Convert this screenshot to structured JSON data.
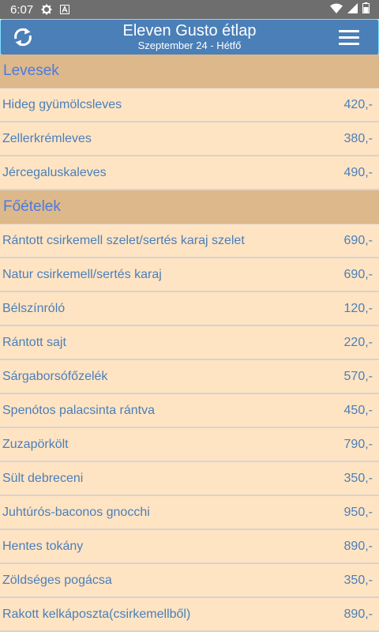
{
  "status_bar": {
    "time": "6:07",
    "icons": [
      "settings-gear-icon",
      "a-notification-icon",
      "wifi-icon",
      "signal-icon",
      "battery-icon"
    ]
  },
  "app_bar": {
    "title": "Eleven Gusto étlap",
    "subtitle": "Szeptember 24 - Hétfő",
    "left_icon": "refresh-icon",
    "right_icon": "hamburger-menu-icon"
  },
  "colors": {
    "app_bar": "#4a7fb8",
    "background": "#ffe4c4",
    "section_header": "#ddb88a",
    "section_text": "#4c7ae0",
    "item_text": "#4a7fb8"
  },
  "sections": [
    {
      "title": "Levesek",
      "items": [
        {
          "name": "Hideg gyümölcsleves",
          "price": "420,-"
        },
        {
          "name": "Zellerkrémleves",
          "price": "380,-"
        },
        {
          "name": "Jércegaluskaleves",
          "price": "490,-"
        }
      ]
    },
    {
      "title": "Főételek",
      "items": [
        {
          "name": "Rántott csirkemell szelet/sertés karaj szelet",
          "price": "690,-"
        },
        {
          "name": "Natur csirkemell/sertés karaj",
          "price": "690,-"
        },
        {
          "name": "Bélszínróló",
          "price": "120,-"
        },
        {
          "name": "Rántott sajt",
          "price": "220,-"
        },
        {
          "name": "Sárgaborsófőzelék",
          "price": "570,-"
        },
        {
          "name": "Spenótos palacsinta rántva",
          "price": "450,-"
        },
        {
          "name": "Zuzapörkölt",
          "price": "790,-"
        },
        {
          "name": "Sült debreceni",
          "price": "350,-"
        },
        {
          "name": "Juhtúrós-baconos gnocchi",
          "price": "950,-"
        },
        {
          "name": "Hentes tokány",
          "price": "890,-"
        },
        {
          "name": "Zöldséges pogácsa",
          "price": "350,-"
        },
        {
          "name": "Rakott kelkáposzta(csirkemellből)",
          "price": "890,-"
        }
      ]
    }
  ]
}
